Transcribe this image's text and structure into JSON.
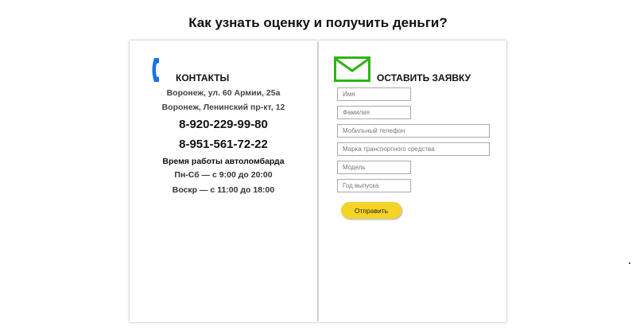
{
  "page": {
    "title": "Как узнать оценку и получить деньги?"
  },
  "contacts": {
    "title": "КОНТАКТЫ",
    "icon": "phone-icon",
    "icon_color": "#1a73e8",
    "address1": "Воронеж, ул. 60 Армии, 25а",
    "address2": "Воронеж, Ленинский пр-кт, 12",
    "phone1": "8-920-229-99-80",
    "phone2": "8-951-561-72-22",
    "hours_title": "Время работы автоломбарда",
    "hours_weekdays": "Пн-Сб — с 9:00 до 20:00",
    "hours_sunday": "Воскр — с 11:00 до 18:00"
  },
  "form": {
    "title": "ОСТАВИТЬ ЗАЯВКУ",
    "icon": "envelope-icon",
    "icon_color": "#2db314",
    "fields": {
      "name": {
        "placeholder": "Имя",
        "value": ""
      },
      "surname": {
        "placeholder": "Фамилия",
        "value": ""
      },
      "phone": {
        "placeholder": "Мобильный телефон",
        "value": ""
      },
      "vehicle": {
        "placeholder": "Марка транспортного средства",
        "value": ""
      },
      "model": {
        "placeholder": "Модель",
        "value": ""
      },
      "year": {
        "placeholder": "Год выпуска",
        "value": ""
      }
    },
    "submit_label": "Отправить",
    "submit_color": "#f5d327"
  }
}
